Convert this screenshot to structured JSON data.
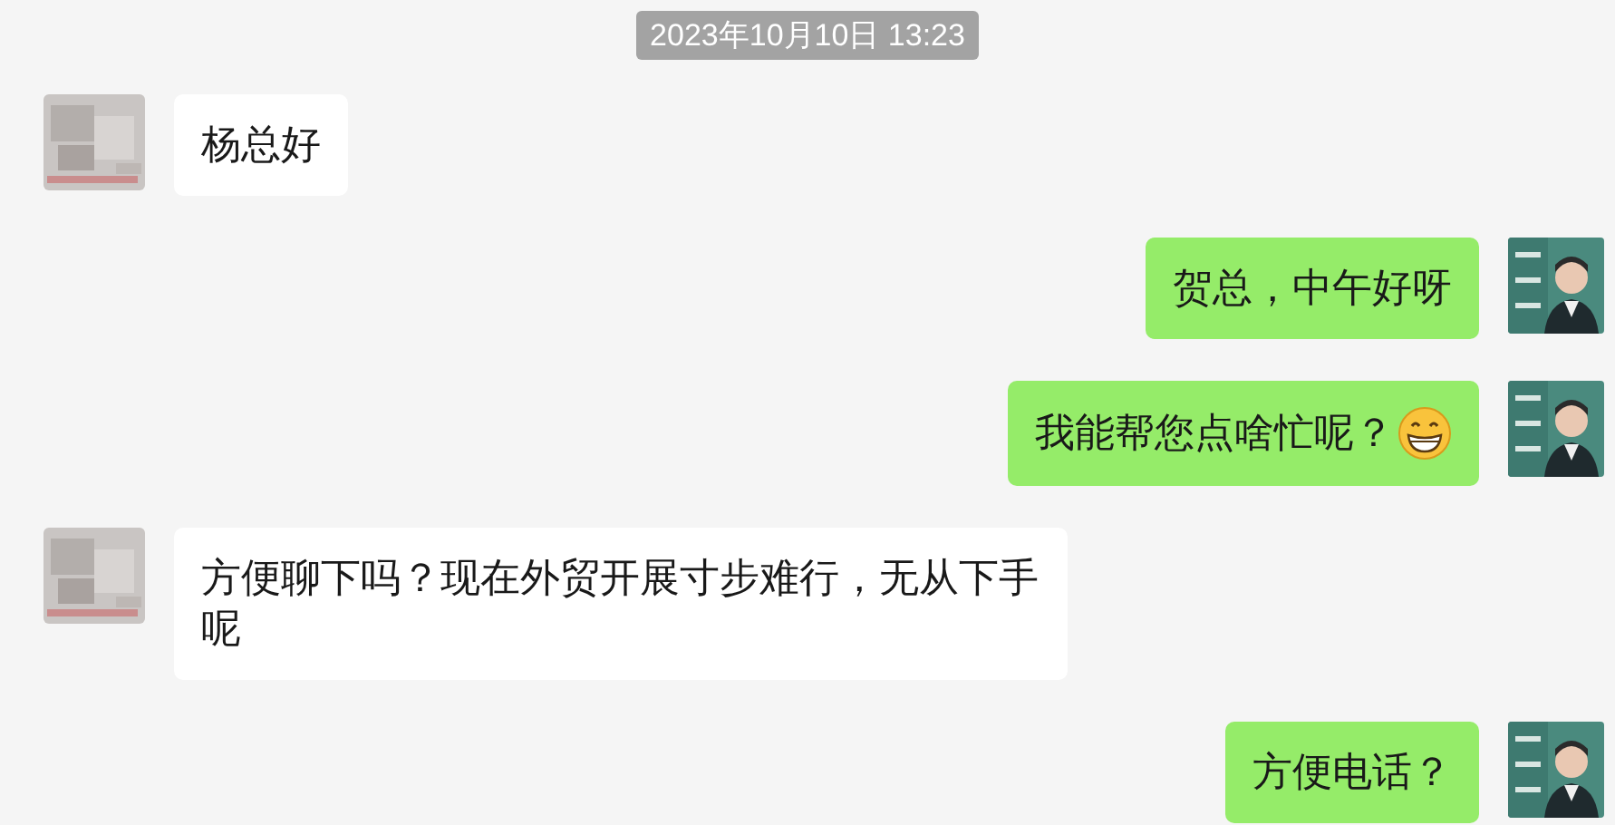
{
  "timestamp": "2023年10月10日 13:23",
  "messages": [
    {
      "kind": "received",
      "text": "杨总好",
      "emoji": false
    },
    {
      "kind": "sent",
      "text": "贺总，中午好呀",
      "emoji": false
    },
    {
      "kind": "sent",
      "text": "我能帮您点啥忙呢？",
      "emoji": true
    },
    {
      "kind": "received",
      "text": "方便聊下吗？现在外贸开展寸步难行，无从下手呢",
      "emoji": false
    },
    {
      "kind": "sent",
      "text": "方便电话？",
      "emoji": false
    }
  ]
}
